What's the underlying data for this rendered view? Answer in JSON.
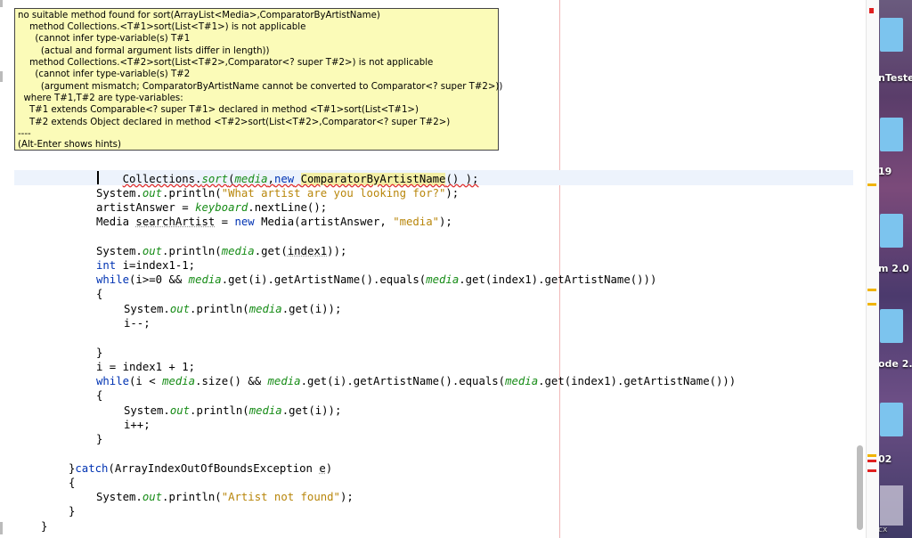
{
  "tooltip": {
    "lines": [
      "no suitable method found for sort(ArrayList<Media>,ComparatorByArtistName)",
      "    method Collections.<T#1>sort(List<T#1>) is not applicable",
      "      (cannot infer type-variable(s) T#1",
      "        (actual and formal argument lists differ in length))",
      "    method Collections.<T#2>sort(List<T#2>,Comparator<? super T#2>) is not applicable",
      "      (cannot infer type-variable(s) T#2",
      "        (argument mismatch; ComparatorByArtistName cannot be converted to Comparator<? super T#2>))",
      "  where T#1,T#2 are type-variables:",
      "    T#1 extends Comparable<? super T#1> declared in method <T#1>sort(List<T#1>)",
      "    T#2 extends Object declared in method <T#2>sort(List<T#2>,Comparator<? super T#2>)",
      "----",
      "(Alt-Enter shows hints)"
    ]
  },
  "code": {
    "sort_a": "Collections.",
    "sort_b": "sort",
    "sort_c": "(",
    "sort_d": "media",
    "sort_e": ",",
    "sort_f": "new",
    "sort_g": " ",
    "sort_h": "ComparatorByArtistName",
    "sort_i": "() );",
    "l3_a": "System.",
    "l3_b": "out",
    "l3_c": ".println(",
    "l3_d": "\"What artist are you looking for?\"",
    "l3_e": ");",
    "l4_a": "artistAnswer = ",
    "l4_b": "keyboard",
    "l4_c": ".nextLine();",
    "l5_a": "Media ",
    "l5_b": "searchArtist",
    "l5_c": " = ",
    "l5_d": "new",
    "l5_e": " Media(artistAnswer, ",
    "l5_f": "\"media\"",
    "l5_g": ");",
    "l7_a": "System.",
    "l7_b": "out",
    "l7_c": ".println(",
    "l7_d": "media",
    "l7_e": ".get(",
    "l7_f": "index1",
    "l7_g": "));",
    "l8_a": "int",
    "l8_b": " i=index1-1;",
    "l9_a": "while",
    "l9_b": "(i>=0 && ",
    "l9_c": "media",
    "l9_d": ".get(i).getArtistName().equals(",
    "l9_e": "media",
    "l9_f": ".get(index1).getArtistName()))",
    "l10": "{",
    "l11_a": "System.",
    "l11_b": "out",
    "l11_c": ".println(",
    "l11_d": "media",
    "l11_e": ".get(i));",
    "l12": "i--;",
    "l14": "}",
    "l15": "i = index1 + 1;",
    "l16_a": "while",
    "l16_b": "(i < ",
    "l16_c": "media",
    "l16_d": ".size() && ",
    "l16_e": "media",
    "l16_f": ".get(i).getArtistName().equals(",
    "l16_g": "media",
    "l16_h": ".get(index1).getArtistName()))",
    "l17": "{",
    "l18_a": "System.",
    "l18_b": "out",
    "l18_c": ".println(",
    "l18_d": "media",
    "l18_e": ".get(i));",
    "l19": "i++;",
    "l20": "}",
    "l22_a": "}",
    "l22_b": "catch",
    "l22_c": "(ArrayIndexOutOfBoundsException ",
    "l22_d": "e",
    "l22_e": ")",
    "l23": "{",
    "l24_a": "System.",
    "l24_b": "out",
    "l24_c": ".println(",
    "l24_d": "\"Artist not found\"",
    "l24_e": ");",
    "l25": "}",
    "l26": "}"
  },
  "desktop": {
    "labels": [
      "nTeste",
      "19",
      "m 2.0",
      "ode 2.",
      "02",
      "cx"
    ]
  },
  "colors": {
    "keyword": "#0033b3",
    "string": "#b8860b",
    "field": "#178c17",
    "tooltip_bg": "#fbfbb8",
    "error_marker": "#e02020",
    "warning_marker": "#f0b400"
  }
}
